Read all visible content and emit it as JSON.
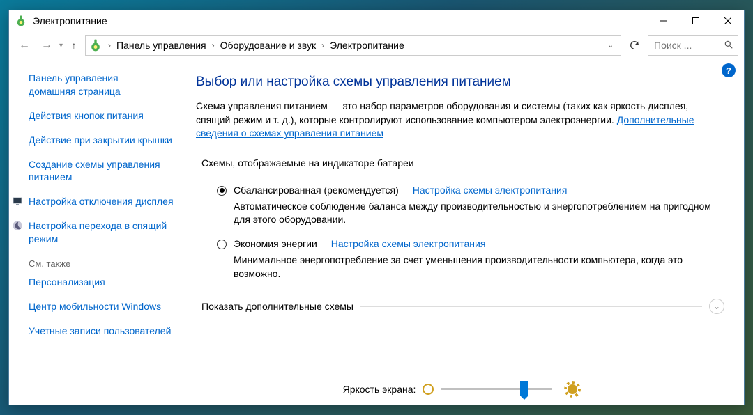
{
  "window": {
    "title": "Электропитание"
  },
  "breadcrumb": {
    "items": [
      "Панель управления",
      "Оборудование и звук",
      "Электропитание"
    ]
  },
  "search": {
    "placeholder": "Поиск ..."
  },
  "sidebar": {
    "home": "Панель управления — домашняя страница",
    "links": [
      "Действия кнопок питания",
      "Действие при закрытии крышки",
      "Создание схемы управления питанием",
      "Настройка отключения дисплея",
      "Настройка перехода в спящий режим"
    ],
    "see_also_label": "См. также",
    "see_also": [
      "Персонализация",
      "Центр мобильности Windows",
      "Учетные записи пользователей"
    ]
  },
  "main": {
    "heading": "Выбор или настройка схемы управления питанием",
    "intro_text": "Схема управления питанием — это набор параметров оборудования и системы (таких как яркость дисплея, спящий режим и т. д.), которые контролируют использование компьютером электроэнергии.",
    "intro_link": "Дополнительные сведения о схемах управления питанием",
    "group_label": "Схемы, отображаемые на индикаторе батареи",
    "plans": [
      {
        "name": "Сбалансированная (рекомендуется)",
        "desc": "Автоматическое соблюдение баланса между производительностью и энергопотреблением на пригодном для этого оборудовании.",
        "link": "Настройка схемы электропитания",
        "selected": true
      },
      {
        "name": "Экономия энергии",
        "desc": "Минимальное энергопотребление за счет уменьшения производительности компьютера, когда это возможно.",
        "link": "Настройка схемы электропитания",
        "selected": false
      }
    ],
    "expander_label": "Показать дополнительные схемы",
    "brightness_label": "Яркость экрана:"
  }
}
